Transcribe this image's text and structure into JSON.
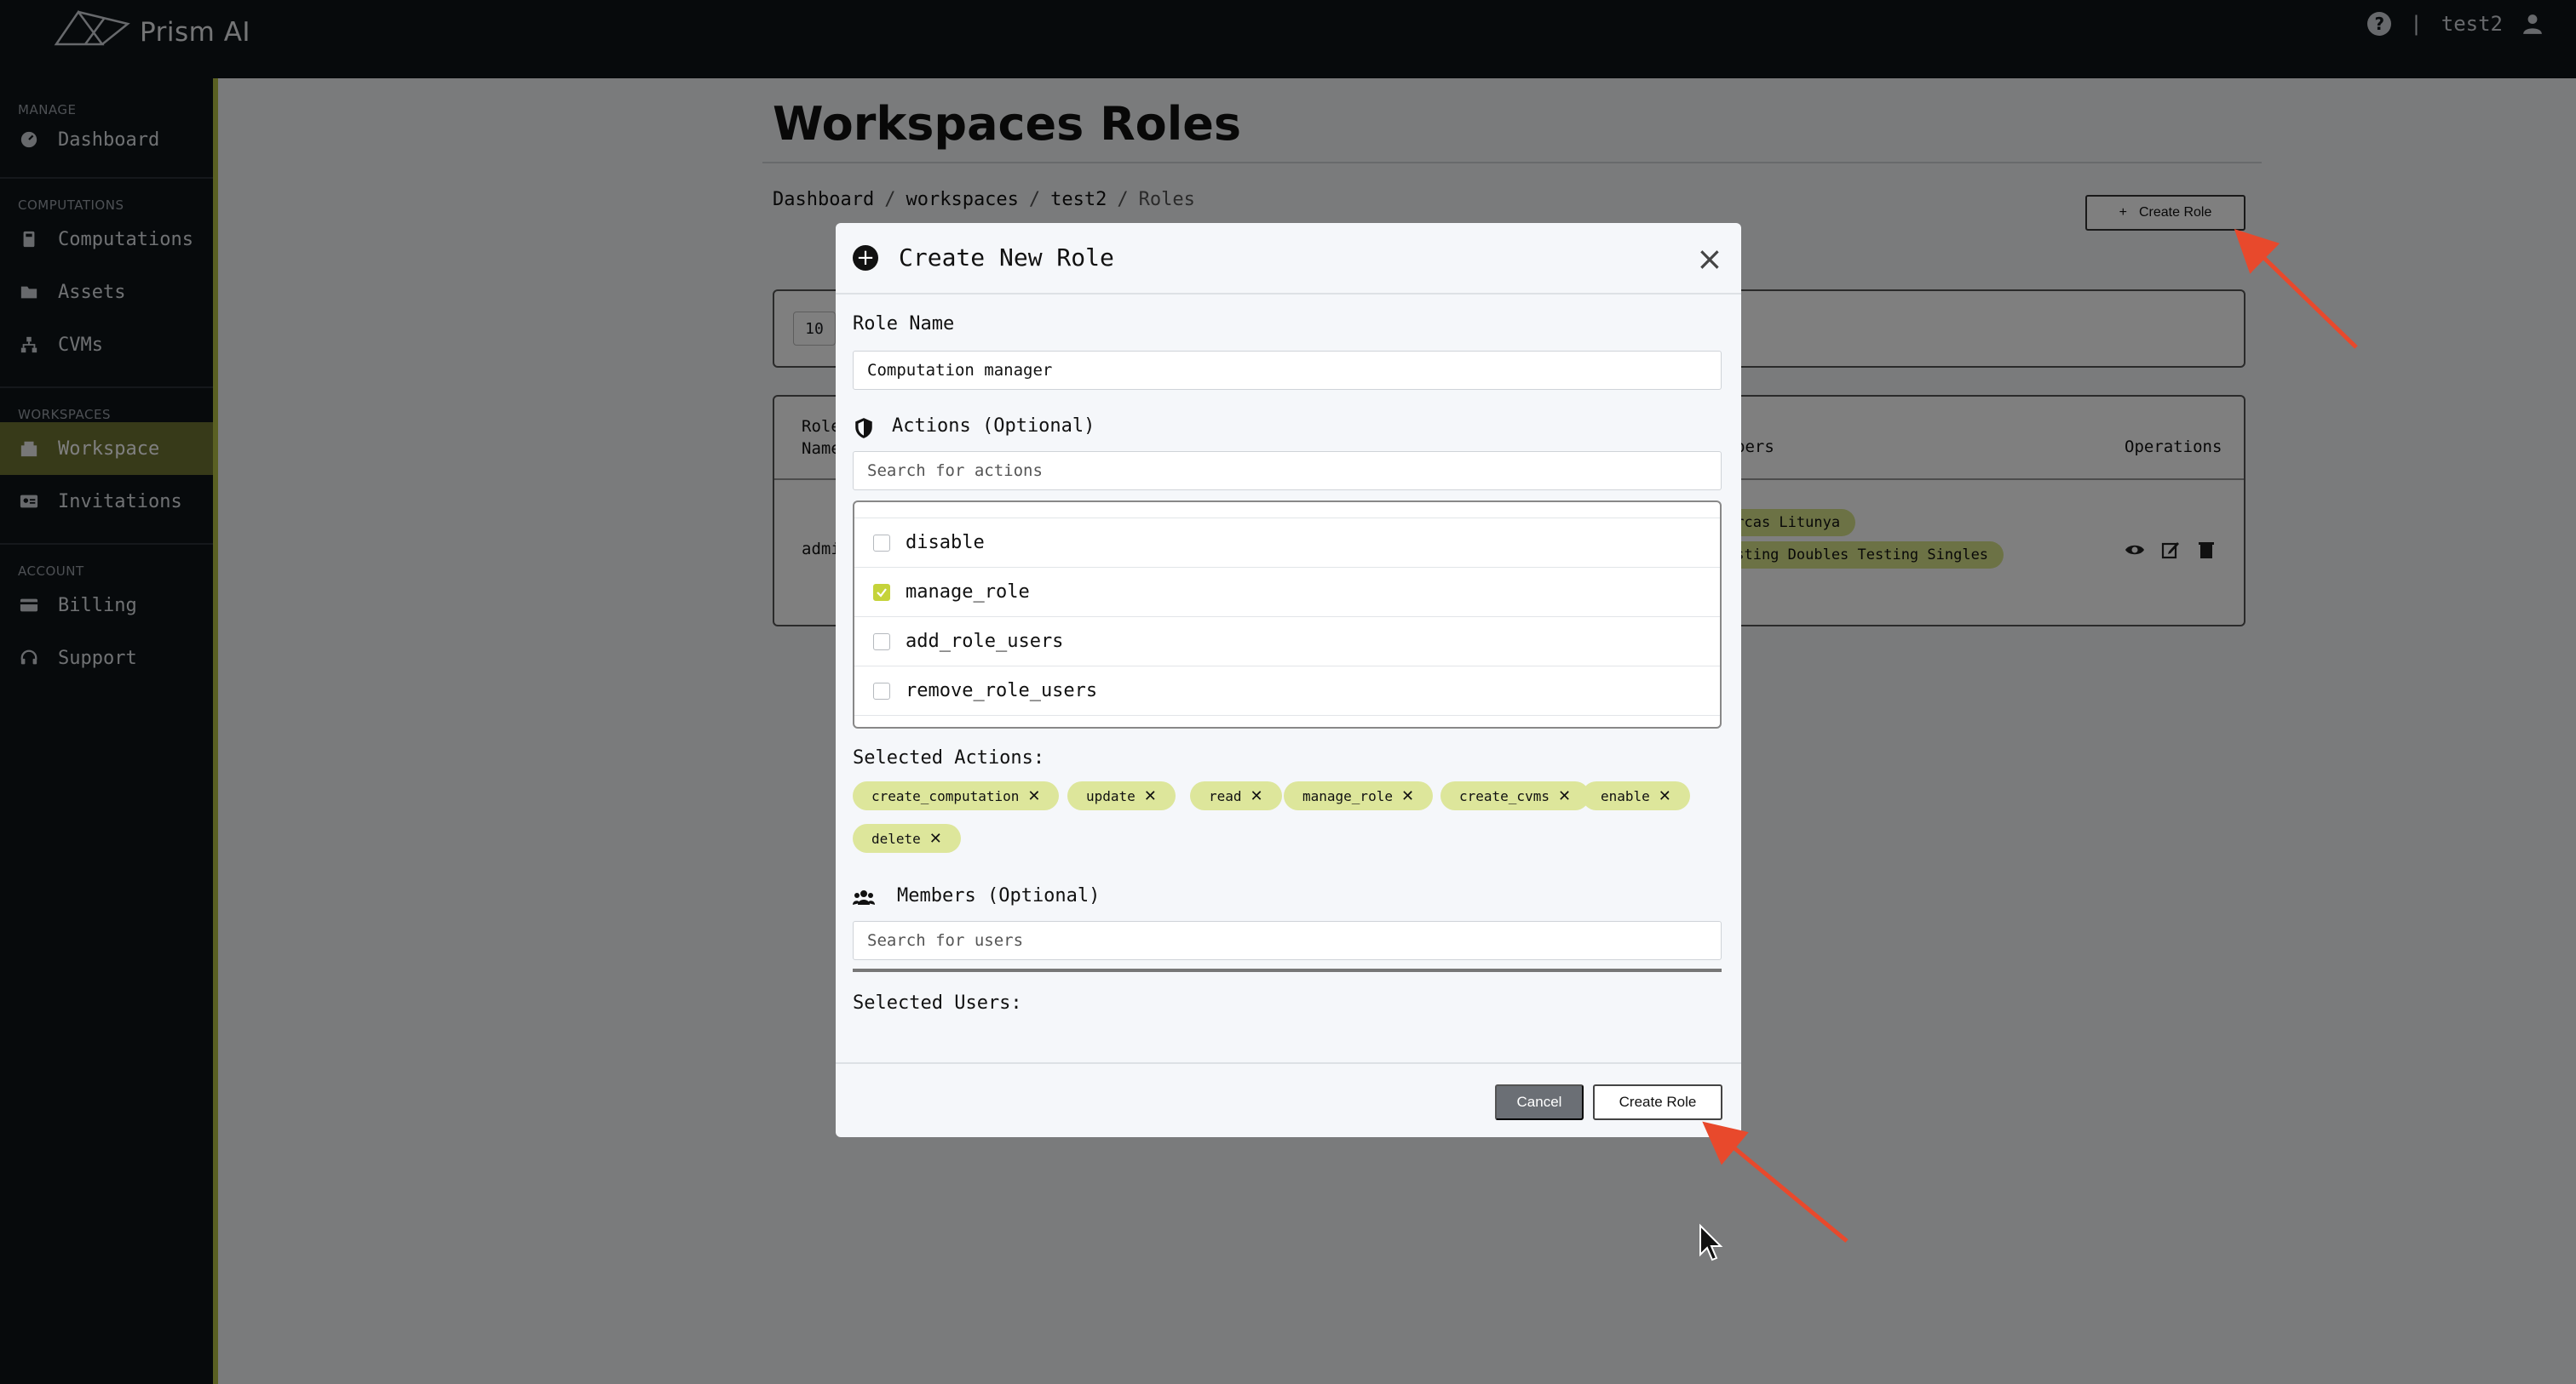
{
  "app": {
    "name": "Prism AI",
    "username": "test2",
    "separator": "|",
    "help_glyph": "?"
  },
  "sidebar": {
    "sections": [
      {
        "label": "MANAGE",
        "items": [
          {
            "label": "Dashboard",
            "icon": "dashboard-icon"
          }
        ]
      },
      {
        "label": "COMPUTATIONS",
        "items": [
          {
            "label": "Computations",
            "icon": "computations-icon"
          },
          {
            "label": "Assets",
            "icon": "folder-icon"
          },
          {
            "label": "CVMs",
            "icon": "sitemap-icon"
          }
        ]
      },
      {
        "label": "WORKSPACES",
        "items": [
          {
            "label": "Workspace",
            "icon": "building-icon",
            "active": true
          },
          {
            "label": "Invitations",
            "icon": "id-card-icon"
          }
        ]
      },
      {
        "label": "ACCOUNT",
        "items": [
          {
            "label": "Billing",
            "icon": "credit-card-icon"
          },
          {
            "label": "Support",
            "icon": "headset-icon"
          }
        ]
      }
    ]
  },
  "page": {
    "title": "Workspaces Roles",
    "breadcrumb": {
      "items": [
        "Dashboard",
        "workspaces",
        "test2"
      ],
      "current": "Roles",
      "separator": "/"
    },
    "create_role_button": "Create Role",
    "create_role_plus": "+",
    "page_size": "10",
    "table": {
      "headers": {
        "role_name": "Role\nName",
        "members": "bers",
        "operations": "Operations"
      },
      "row": {
        "role_name": "admi",
        "members": [
          "orcas Litunya",
          "esting Doubles Testing Singles"
        ]
      }
    }
  },
  "modal": {
    "title": "Create New Role",
    "close_glyph": "×",
    "role_name_label": "Role Name",
    "role_name_value": "Computation manager",
    "actions_label": "Actions (Optional)",
    "actions_search_placeholder": "Search for actions",
    "action_options": [
      {
        "name": "disable",
        "checked": false
      },
      {
        "name": "manage_role",
        "checked": true
      },
      {
        "name": "add_role_users",
        "checked": false
      },
      {
        "name": "remove_role_users",
        "checked": false
      }
    ],
    "selected_actions_label": "Selected Actions:",
    "selected_actions": [
      "create_computation",
      "update",
      "read",
      "manage_role",
      "create_cvms",
      "enable",
      "delete"
    ],
    "chip_remove_glyph": "✕",
    "members_label": "Members (Optional)",
    "members_search_placeholder": "Search for users",
    "selected_users_label": "Selected Users:",
    "cancel_button": "Cancel",
    "create_button": "Create Role"
  },
  "colors": {
    "accent": "#b4c146",
    "chip": "#dde69b",
    "topbar": "#0f1419",
    "annotation_arrow": "#e8492c"
  }
}
